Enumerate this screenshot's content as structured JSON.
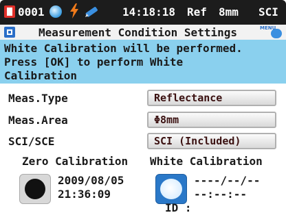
{
  "statusbar": {
    "number": "0001",
    "time": "14:18:18",
    "ref": "Ref",
    "area": "8mm",
    "mode": "SCI"
  },
  "title": {
    "text": "Measurement Condition Settings",
    "menu_label": "MENU"
  },
  "message": {
    "text": "White Calibration will be performed.\nPress [OK] to perform White\nCalibration"
  },
  "settings": [
    {
      "label": "Meas.Type",
      "value": "Reflectance"
    },
    {
      "label": "Meas.Area",
      "value": "Φ8mm"
    },
    {
      "label": "SCI/SCE",
      "value": "SCI (Included)"
    }
  ],
  "zero_calibration": {
    "label": "Zero Calibration",
    "date": "2009/08/05",
    "time": "21:36:09"
  },
  "white_calibration": {
    "label": "White Calibration",
    "date": "----/--/--",
    "time": "--:--:--",
    "id_label": "ID :"
  },
  "colors": {
    "statusbar_bg": "#1c1c1c",
    "message_bg": "#8ad0ee",
    "mem_icon": "#e0302a",
    "accent_blue": "#2a78c8"
  },
  "icons": [
    "memory-icon",
    "power-status-icon",
    "battery-bolt-icon",
    "pen-icon",
    "settings-icon",
    "menu-icon"
  ]
}
